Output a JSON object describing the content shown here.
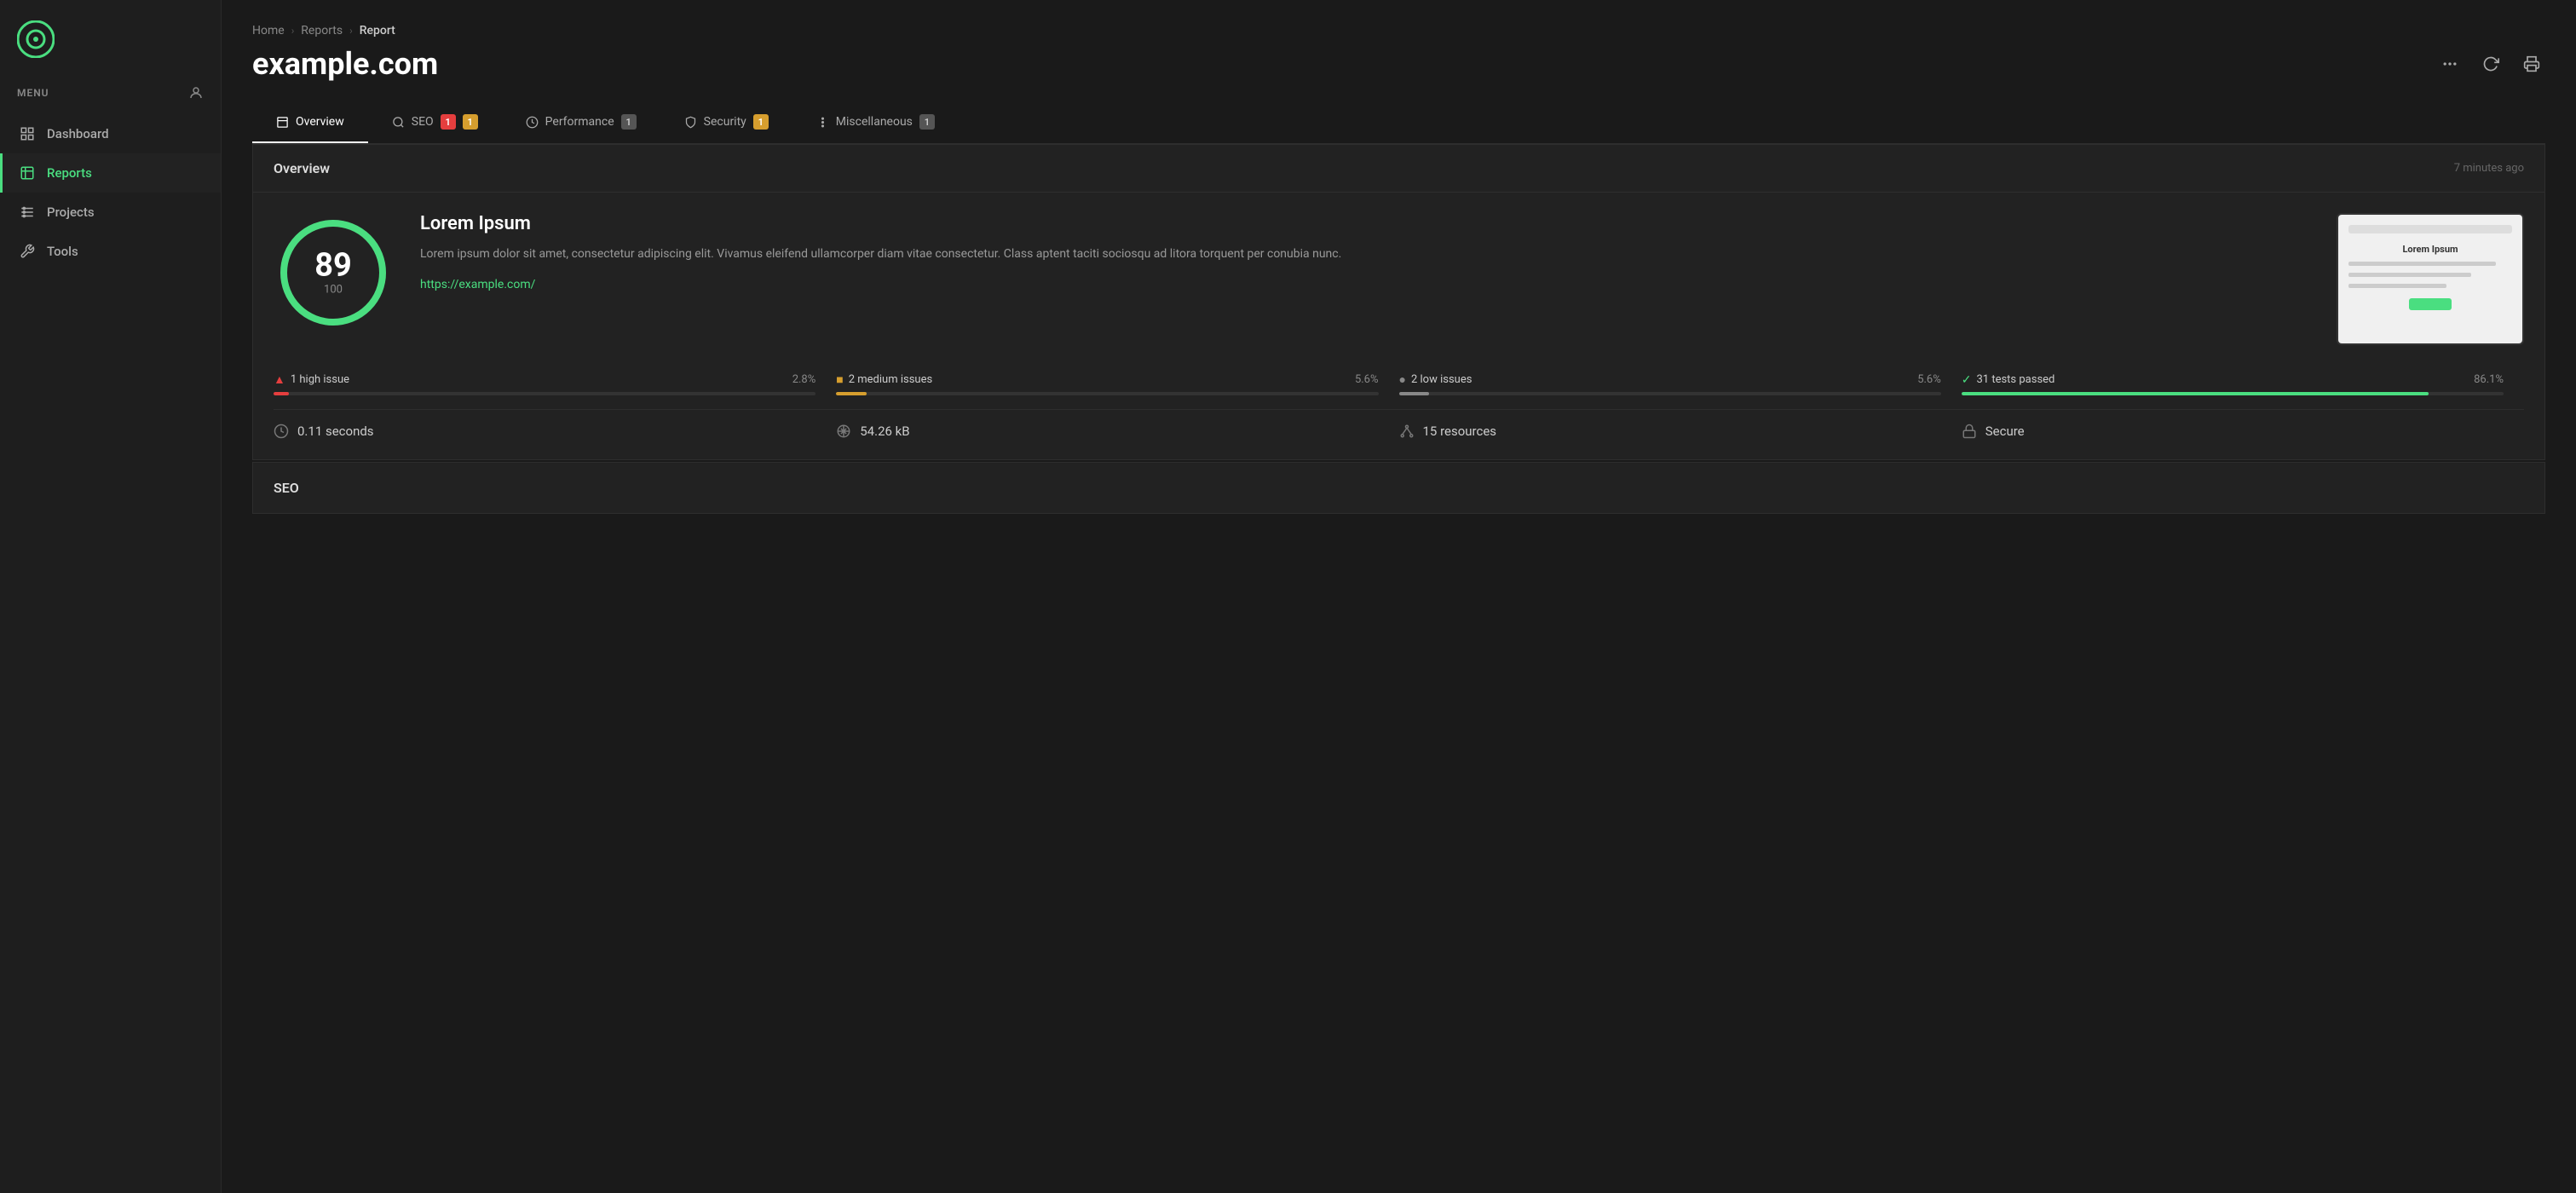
{
  "sidebar": {
    "menu_label": "MENU",
    "items": [
      {
        "id": "dashboard",
        "label": "Dashboard",
        "active": false
      },
      {
        "id": "reports",
        "label": "Reports",
        "active": true
      },
      {
        "id": "projects",
        "label": "Projects",
        "active": false
      },
      {
        "id": "tools",
        "label": "Tools",
        "active": false
      }
    ]
  },
  "breadcrumb": {
    "home": "Home",
    "reports": "Reports",
    "current": "Report"
  },
  "header": {
    "title": "example.com",
    "actions": [
      "more",
      "refresh",
      "print"
    ]
  },
  "tabs": [
    {
      "id": "overview",
      "label": "Overview",
      "badge": null,
      "badge_type": null,
      "active": true
    },
    {
      "id": "seo",
      "label": "SEO",
      "badge": "1",
      "badge2": "1",
      "badge_type": "mixed",
      "active": false
    },
    {
      "id": "performance",
      "label": "Performance",
      "badge": "1",
      "badge_type": "gray",
      "active": false
    },
    {
      "id": "security",
      "label": "Security",
      "badge": "1",
      "badge_type": "yellow",
      "active": false
    },
    {
      "id": "miscellaneous",
      "label": "Miscellaneous",
      "badge": "1",
      "badge_type": "gray",
      "active": false
    }
  ],
  "overview": {
    "title": "Overview",
    "timestamp": "7 minutes ago",
    "score": {
      "value": "89",
      "total": "100",
      "percent": 89
    },
    "site_name": "Lorem Ipsum",
    "description": "Lorem ipsum dolor sit amet, consectetur adipiscing elit. Vivamus eleifend ullamcorper diam vitae consectetur. Class aptent taciti sociosqu ad litora torquent per conubia nunc.",
    "url": "https://example.com/",
    "issues": [
      {
        "label": "1 high issue",
        "pct": "2.8%",
        "color": "#e53e3e",
        "fill_pct": 2.8,
        "icon": "▲"
      },
      {
        "label": "2 medium issues",
        "pct": "5.6%",
        "color": "#d69e2e",
        "fill_pct": 5.6,
        "icon": "■"
      },
      {
        "label": "2 low issues",
        "pct": "5.6%",
        "color": "#888",
        "fill_pct": 5.6,
        "icon": "●"
      },
      {
        "label": "31 tests passed",
        "pct": "86.1%",
        "color": "#4ade80",
        "fill_pct": 86.1,
        "icon": "✓"
      }
    ],
    "metrics": [
      {
        "icon": "timer",
        "value": "0.11 seconds"
      },
      {
        "icon": "scale",
        "value": "54.26 kB"
      },
      {
        "icon": "resources",
        "value": "15 resources"
      },
      {
        "icon": "lock",
        "value": "Secure"
      }
    ]
  },
  "seo": {
    "title": "SEO"
  }
}
